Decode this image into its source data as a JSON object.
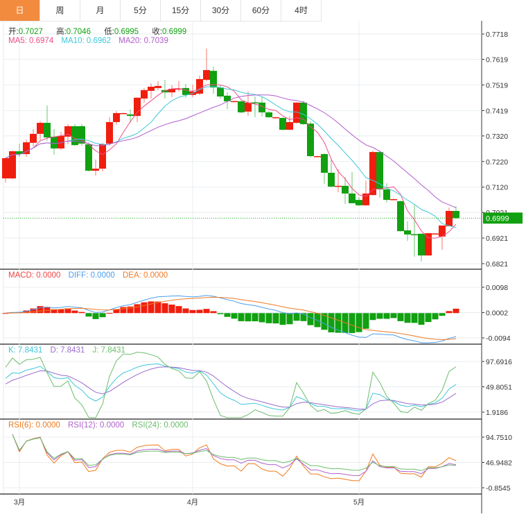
{
  "tabs": [
    {
      "label": "日",
      "active": true
    },
    {
      "label": "周"
    },
    {
      "label": "月"
    },
    {
      "label": "5分"
    },
    {
      "label": "15分"
    },
    {
      "label": "30分"
    },
    {
      "label": "60分"
    },
    {
      "label": "4时"
    }
  ],
  "ohlc_legend": {
    "open_label": "开:",
    "open": "0.7027",
    "high_label": "高:",
    "high": "0.7046",
    "low_label": "低:",
    "low": "0.6995",
    "close_label": "收:",
    "close": "0.6999"
  },
  "ma_legend": {
    "ma5": "MA5: 0.6974",
    "ma10": "MA10: 0.6962",
    "ma20": "MA20: 0.7039"
  },
  "macd_legend": {
    "macd": "MACD: 0.0000",
    "diff": "DIFF: 0.0000",
    "dea": "DEA: 0.0000"
  },
  "kdj_legend": {
    "k": "K: 7.8431",
    "d": "D: 7.8431",
    "j": "J: 7.8431"
  },
  "rsi_legend": {
    "rsi6": "RSI(6): 0.0000",
    "rsi12": "RSI(12): 0.0000",
    "rsi24": "RSI(24): 0.0000"
  },
  "last_price": "0.6999",
  "colors": {
    "up": "#f01e0e",
    "down": "#10a010",
    "ma5": "#ee4c88",
    "ma10": "#3ec6d8",
    "ma20": "#b05ccc",
    "diff": "#4a9eea",
    "dea": "#f07a26",
    "macd_label": "#ee4444",
    "k": "#3ec6d8",
    "d": "#9a6ccc",
    "j": "#6cbc6c",
    "rsi6": "#f07a1a",
    "rsi12": "#b060cc",
    "rsi24": "#6cbc6c",
    "tab_active": "#f28b3e"
  },
  "chart_data": {
    "type": "candlestick",
    "price_axis": {
      "ticks": [
        "0.7718",
        "0.7619",
        "0.7519",
        "0.7419",
        "0.7320",
        "0.7220",
        "0.7120",
        "0.7021",
        "0.6921",
        "0.6821"
      ],
      "ylim": [
        0.6821,
        0.7718
      ]
    },
    "macd_axis": {
      "ticks": [
        "0.0098",
        "0.0002",
        "-0.0094"
      ],
      "ylim": [
        -0.0094,
        0.0098
      ]
    },
    "kdj_axis": {
      "ticks": [
        "97.6916",
        "49.8051",
        "1.9186"
      ],
      "ylim": [
        1.9186,
        97.6916
      ]
    },
    "rsi_axis": {
      "ticks": [
        "94.7510",
        "46.9482",
        "-0.8545"
      ],
      "ylim": [
        -0.8545,
        94.751
      ]
    },
    "x_labels": [
      {
        "label": "3月",
        "index": 2
      },
      {
        "label": "4月",
        "index": 27
      },
      {
        "label": "5月",
        "index": 51
      }
    ],
    "moving_averages": [
      5,
      10,
      20
    ],
    "candles": [
      [
        0.7154,
        0.7236,
        0.7138,
        0.7233
      ],
      [
        0.7154,
        0.7263,
        0.7151,
        0.726
      ],
      [
        0.726,
        0.729,
        0.7238,
        0.7249
      ],
      [
        0.7249,
        0.7306,
        0.7238,
        0.7295
      ],
      [
        0.7293,
        0.7347,
        0.7279,
        0.7328
      ],
      [
        0.7328,
        0.7379,
        0.7303,
        0.7371
      ],
      [
        0.7371,
        0.7439,
        0.7301,
        0.7314
      ],
      [
        0.7317,
        0.7347,
        0.7247,
        0.7271
      ],
      [
        0.7271,
        0.7336,
        0.7265,
        0.732
      ],
      [
        0.7317,
        0.7366,
        0.7287,
        0.7358
      ],
      [
        0.7358,
        0.7366,
        0.7282,
        0.7284
      ],
      [
        0.7358,
        0.7366,
        0.7282,
        0.729
      ],
      [
        0.7287,
        0.7295,
        0.7181,
        0.7184
      ],
      [
        0.7184,
        0.7228,
        0.7165,
        0.7192
      ],
      [
        0.7192,
        0.7293,
        0.7181,
        0.7287
      ],
      [
        0.729,
        0.7393,
        0.7282,
        0.7374
      ],
      [
        0.7374,
        0.7417,
        0.7363,
        0.7409
      ],
      [
        0.7409,
        0.7411,
        0.7406,
        0.7409
      ],
      [
        0.7404,
        0.7423,
        0.7371,
        0.7398
      ],
      [
        0.7398,
        0.7471,
        0.7374,
        0.7469
      ],
      [
        0.7466,
        0.7507,
        0.745,
        0.7499
      ],
      [
        0.7496,
        0.7526,
        0.7466,
        0.7512
      ],
      [
        0.7507,
        0.7534,
        0.7499,
        0.7515
      ],
      [
        0.7499,
        0.7539,
        0.7466,
        0.749
      ],
      [
        0.749,
        0.7518,
        0.7471,
        0.7504
      ],
      [
        0.7503,
        0.7534,
        0.7493,
        0.7505
      ],
      [
        0.7507,
        0.7523,
        0.7469,
        0.748
      ],
      [
        0.748,
        0.752,
        0.7471,
        0.7493
      ],
      [
        0.7485,
        0.7555,
        0.748,
        0.7542
      ],
      [
        0.7539,
        0.7661,
        0.7534,
        0.7577
      ],
      [
        0.7574,
        0.7591,
        0.7485,
        0.7509
      ],
      [
        0.7509,
        0.7518,
        0.7466,
        0.7474
      ],
      [
        0.7477,
        0.749,
        0.7425,
        0.7455
      ],
      [
        0.7454,
        0.7457,
        0.7452,
        0.7456
      ],
      [
        0.7455,
        0.7458,
        0.7409,
        0.7412
      ],
      [
        0.7415,
        0.7493,
        0.7398,
        0.745
      ],
      [
        0.7451,
        0.7474,
        0.7393,
        0.7449
      ],
      [
        0.745,
        0.7474,
        0.7396,
        0.7412
      ],
      [
        0.7412,
        0.7417,
        0.739,
        0.7393
      ],
      [
        0.7392,
        0.7395,
        0.739,
        0.7393
      ],
      [
        0.739,
        0.7393,
        0.7341,
        0.7344
      ],
      [
        0.7344,
        0.7398,
        0.7344,
        0.7374
      ],
      [
        0.7371,
        0.7452,
        0.7368,
        0.745
      ],
      [
        0.745,
        0.7458,
        0.7363,
        0.7366
      ],
      [
        0.7368,
        0.7377,
        0.7236,
        0.7241
      ],
      [
        0.724,
        0.7242,
        0.7239,
        0.7241
      ],
      [
        0.7249,
        0.7252,
        0.7133,
        0.7176
      ],
      [
        0.7176,
        0.7228,
        0.7119,
        0.7122
      ],
      [
        0.7124,
        0.719,
        0.71,
        0.7125
      ],
      [
        0.7125,
        0.716,
        0.7054,
        0.7095
      ],
      [
        0.7095,
        0.7179,
        0.7057,
        0.7057
      ],
      [
        0.707,
        0.7081,
        0.7046,
        0.7049
      ],
      [
        0.7049,
        0.7146,
        0.7046,
        0.7095
      ],
      [
        0.7089,
        0.7263,
        0.7087,
        0.7257
      ],
      [
        0.7257,
        0.7263,
        0.7078,
        0.7111
      ],
      [
        0.7111,
        0.7135,
        0.706,
        0.707
      ],
      [
        0.7072,
        0.7075,
        0.7071,
        0.7073
      ],
      [
        0.7065,
        0.7067,
        0.6946,
        0.6948
      ],
      [
        0.6951,
        0.6986,
        0.691,
        0.6935
      ],
      [
        0.6936,
        0.7051,
        0.6848,
        0.6935
      ],
      [
        0.6938,
        0.6938,
        0.6829,
        0.6853
      ],
      [
        0.6853,
        0.694,
        0.6853,
        0.694
      ],
      [
        0.6938,
        0.694,
        0.6937,
        0.6939
      ],
      [
        0.6927,
        0.697,
        0.6875,
        0.697
      ],
      [
        0.6967,
        0.704,
        0.6967,
        0.7027
      ],
      [
        0.7027,
        0.7046,
        0.6995,
        0.6999
      ]
    ]
  }
}
